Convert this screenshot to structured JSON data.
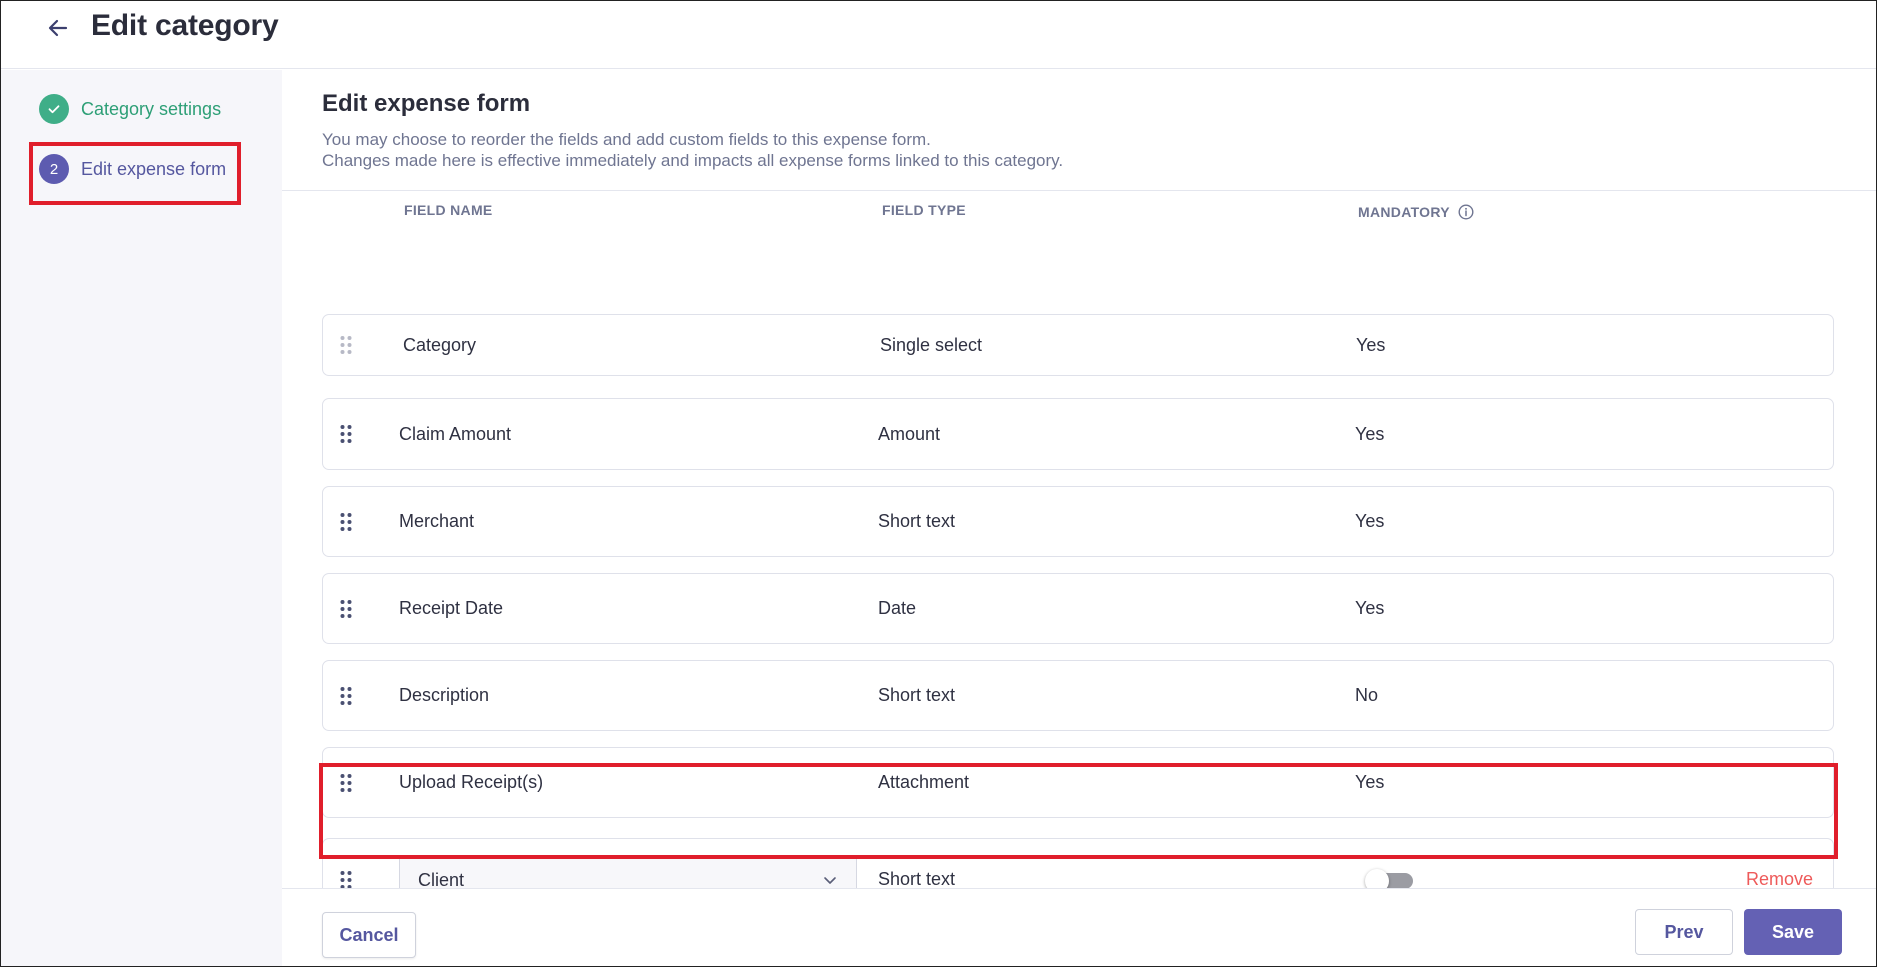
{
  "header": {
    "title": "Edit category"
  },
  "sidebar": {
    "steps": [
      {
        "label": "Category settings",
        "state": "done"
      },
      {
        "number": "2",
        "label": "Edit expense form",
        "state": "active"
      }
    ]
  },
  "main": {
    "title": "Edit expense form",
    "description_line1": "You may choose to reorder the fields and add custom fields to this expense form.",
    "description_line2": "Changes made here is effective immediately and impacts all expense forms linked to this category.",
    "columns": {
      "field_name": "FIELD NAME",
      "field_type": "FIELD TYPE",
      "mandatory": "MANDATORY"
    },
    "rows": [
      {
        "name": "Category",
        "type": "Single select",
        "mandatory": "Yes"
      },
      {
        "name": "Claim Amount",
        "type": "Amount",
        "mandatory": "Yes"
      },
      {
        "name": "Merchant",
        "type": "Short text",
        "mandatory": "Yes"
      },
      {
        "name": "Receipt Date",
        "type": "Date",
        "mandatory": "Yes"
      },
      {
        "name": "Description",
        "type": "Short text",
        "mandatory": "No"
      },
      {
        "name": "Upload Receipt(s)",
        "type": "Attachment",
        "mandatory": "Yes"
      }
    ],
    "custom_row": {
      "selected_field": "Client",
      "type": "Short text",
      "mandatory_on": false,
      "remove_label": "Remove"
    }
  },
  "footer": {
    "cancel_label": "Cancel",
    "prev_label": "Prev",
    "save_label": "Save"
  },
  "colors": {
    "accent": "#6461b4",
    "success": "#3fae88",
    "danger": "#ee5a5a",
    "highlight": "#e01e2b"
  }
}
